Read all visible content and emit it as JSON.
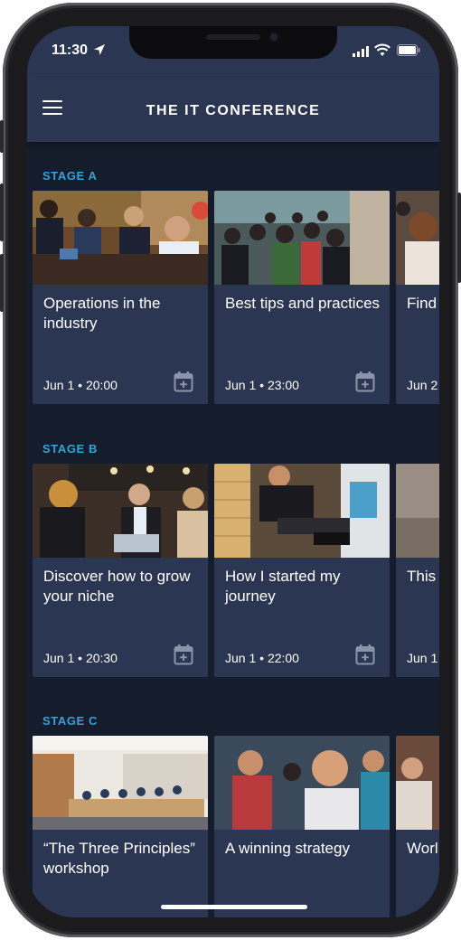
{
  "status_bar": {
    "time": "11:30"
  },
  "header": {
    "title": "THE IT CONFERENCE",
    "menu_icon": "hamburger-menu-icon"
  },
  "colors": {
    "background": "#151c2b",
    "surface": "#2b3752",
    "accent": "#33a3d9",
    "text": "#ffffff"
  },
  "stages": [
    {
      "title": "STAGE A",
      "sessions": [
        {
          "title": "Operations in the industry",
          "date": "Jun 1",
          "time": "20:00",
          "icon": "calendar-add-icon"
        },
        {
          "title": "Best tips and practices",
          "date": "Jun 1",
          "time": "23:00",
          "icon": "calendar-add-icon"
        },
        {
          "title": "Find",
          "date": "Jun 2",
          "time": "",
          "icon": "calendar-add-icon"
        }
      ]
    },
    {
      "title": "STAGE B",
      "sessions": [
        {
          "title": "Discover how to grow your niche",
          "date": "Jun 1",
          "time": "20:30",
          "icon": "calendar-add-icon"
        },
        {
          "title": "How I started my journey",
          "date": "Jun 1",
          "time": "22:00",
          "icon": "calendar-add-icon"
        },
        {
          "title": "This",
          "date": "Jun 1",
          "time": "",
          "icon": "calendar-add-icon"
        }
      ]
    },
    {
      "title": "STAGE C",
      "sessions": [
        {
          "title": "“The Three Principles” workshop",
          "date": "",
          "time": "",
          "icon": "calendar-add-icon"
        },
        {
          "title": "A winning strategy",
          "date": "",
          "time": "",
          "icon": "calendar-add-icon"
        },
        {
          "title": "Worl over",
          "date": "",
          "time": "",
          "icon": "calendar-add-icon"
        }
      ]
    }
  ]
}
